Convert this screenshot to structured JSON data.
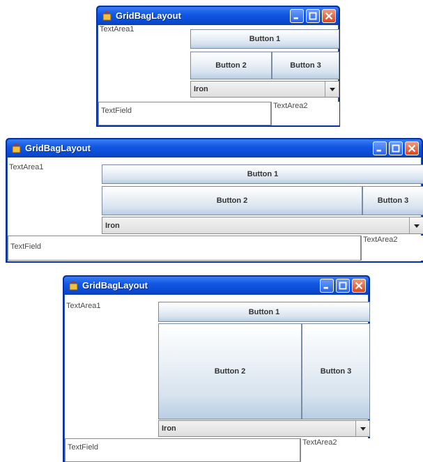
{
  "colors": {
    "titlebar": "#1258e3",
    "close_button": "#d9461f",
    "button_gradient_bottom": "#b9cde3"
  },
  "windows": [
    {
      "title": "GridBagLayout",
      "textarea1": "TextArea1",
      "button1": "Button 1",
      "button2": "Button 2",
      "button3": "Button 3",
      "combo_selected": "Iron",
      "textfield": "TextField",
      "textarea2": "TextArea2"
    },
    {
      "title": "GridBagLayout",
      "textarea1": "TextArea1",
      "button1": "Button 1",
      "button2": "Button 2",
      "button3": "Button 3",
      "combo_selected": "Iron",
      "textfield": "TextField",
      "textarea2": "TextArea2"
    },
    {
      "title": "GridBagLayout",
      "textarea1": "TextArea1",
      "button1": "Button 1",
      "button2": "Button 2",
      "button3": "Button 3",
      "combo_selected": "Iron",
      "textfield": "TextField",
      "textarea2": "TextArea2"
    }
  ]
}
